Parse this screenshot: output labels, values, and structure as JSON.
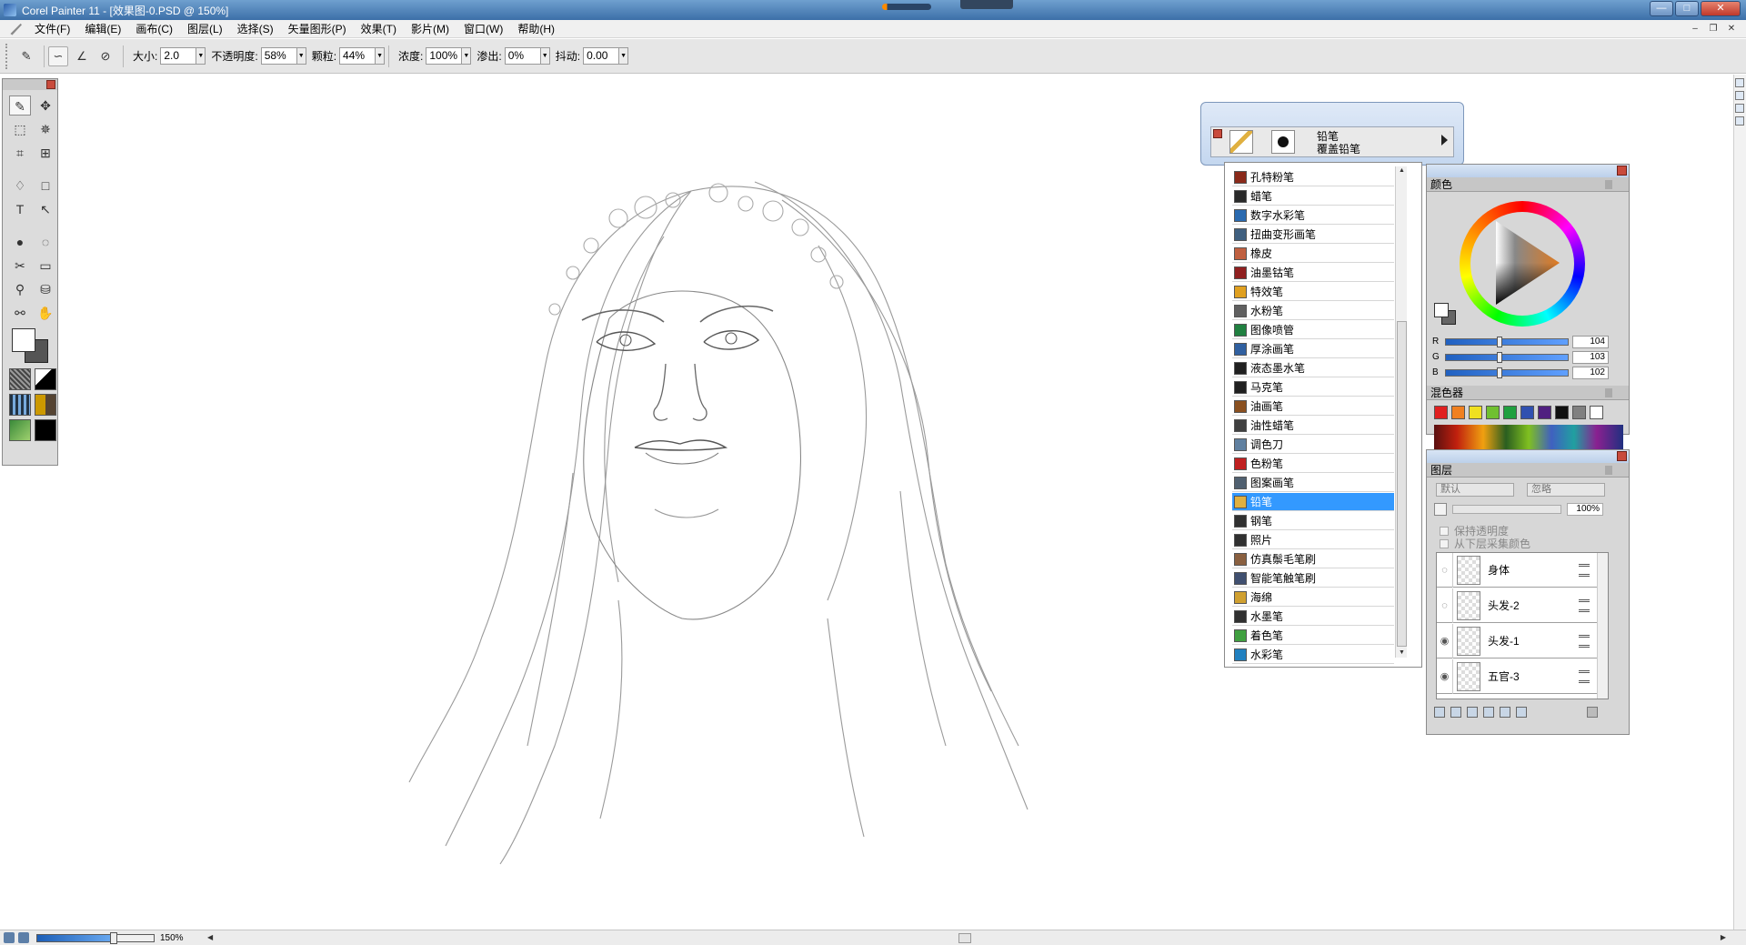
{
  "window": {
    "title": "Corel Painter 11 - [效果图-0.PSD @ 150%]",
    "buttons": {
      "minimize": "—",
      "maximize": "□",
      "close": "✕"
    }
  },
  "menu": [
    "文件(F)",
    "编辑(E)",
    "画布(C)",
    "图层(L)",
    "选择(S)",
    "矢量图形(P)",
    "效果(T)",
    "影片(M)",
    "窗口(W)",
    "帮助(H)"
  ],
  "property_bar": {
    "size_label": "大小:",
    "size_value": "2.0",
    "opacity_label": "不透明度:",
    "opacity_value": "58%",
    "grain_label": "颗粒:",
    "grain_value": "44%",
    "density_label": "浓度:",
    "density_value": "100%",
    "bleed_label": "渗出:",
    "bleed_value": "0%",
    "jitter_label": "抖动:",
    "jitter_value": "0.00"
  },
  "brush_selector": {
    "category": "铅笔",
    "variant": "覆盖铅笔",
    "categories": [
      {
        "label": "孔特粉笔",
        "icon_color": "#8a2a1a"
      },
      {
        "label": "蜡笔",
        "icon_color": "#2a2a2a"
      },
      {
        "label": "数字水彩笔",
        "icon_color": "#2a6ab0"
      },
      {
        "label": "扭曲变形画笔",
        "icon_color": "#406080"
      },
      {
        "label": "橡皮",
        "icon_color": "#c06040"
      },
      {
        "label": "油墨钴笔",
        "icon_color": "#902020"
      },
      {
        "label": "特效笔",
        "icon_color": "#e0a020"
      },
      {
        "label": "水粉笔",
        "icon_color": "#606060"
      },
      {
        "label": "图像喷管",
        "icon_color": "#208040"
      },
      {
        "label": "厚涂画笔",
        "icon_color": "#3060a0"
      },
      {
        "label": "液态墨水笔",
        "icon_color": "#202020"
      },
      {
        "label": "马克笔",
        "icon_color": "#202020"
      },
      {
        "label": "油画笔",
        "icon_color": "#8a5020"
      },
      {
        "label": "油性蜡笔",
        "icon_color": "#404040"
      },
      {
        "label": "调色刀",
        "icon_color": "#6080a0"
      },
      {
        "label": "色粉笔",
        "icon_color": "#c02020"
      },
      {
        "label": "图案画笔",
        "icon_color": "#506070"
      },
      {
        "label": "铅笔",
        "icon_color": "#e0b040"
      },
      {
        "label": "钢笔",
        "icon_color": "#303030"
      },
      {
        "label": "照片",
        "icon_color": "#303030"
      },
      {
        "label": "仿真鬃毛笔刷",
        "icon_color": "#8a6040"
      },
      {
        "label": "智能笔触笔刷",
        "icon_color": "#405070"
      },
      {
        "label": "海绵",
        "icon_color": "#d0a030"
      },
      {
        "label": "水墨笔",
        "icon_color": "#303030"
      },
      {
        "label": "着色笔",
        "icon_color": "#40a040"
      },
      {
        "label": "水彩笔",
        "icon_color": "#2080c0"
      }
    ],
    "selected_index": 17
  },
  "color_panel": {
    "title": "颜色",
    "r_label": "R",
    "r_value": "104",
    "g_label": "G",
    "g_value": "103",
    "b_label": "B",
    "b_value": "102"
  },
  "mixer_panel": {
    "title": "混色器",
    "swatches": [
      "#e02020",
      "#f08020",
      "#f0e020",
      "#70c030",
      "#20a040",
      "#3050b0",
      "#502080",
      "#101010",
      "#808080",
      "#ffffff"
    ]
  },
  "layers_panel": {
    "title": "图层",
    "composite_method": "默认",
    "composite_depth": "忽略",
    "opacity": "100%",
    "preserve_transparency": "保持透明度",
    "pick_up_underlying": "从下层采集颜色",
    "layers": [
      {
        "name": "身体",
        "visible": false
      },
      {
        "name": "头发-2",
        "visible": false
      },
      {
        "name": "头发-1",
        "visible": true
      },
      {
        "name": "五官-3",
        "visible": true
      }
    ]
  },
  "status": {
    "zoom": "150%"
  }
}
